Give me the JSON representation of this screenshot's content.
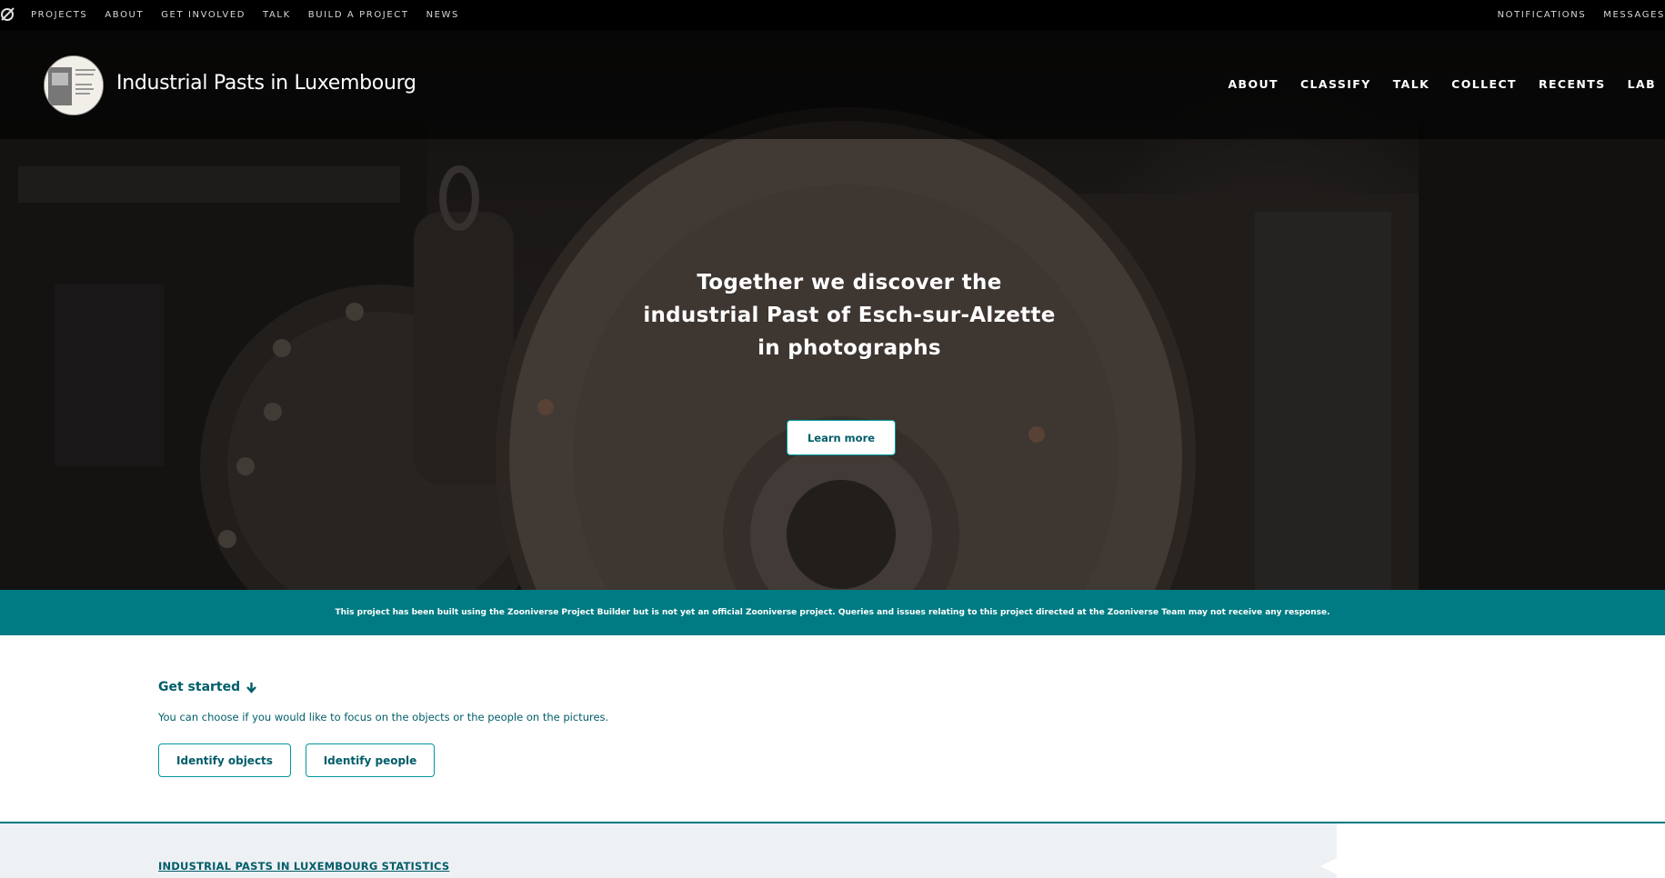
{
  "topbar": {
    "logo_icon": "zooniverse-logo-icon",
    "links": [
      "PROJECTS",
      "ABOUT",
      "GET INVOLVED",
      "TALK",
      "BUILD A PROJECT",
      "NEWS"
    ],
    "right_links": [
      "NOTIFICATIONS",
      "MESSAGES"
    ]
  },
  "project": {
    "title": "Industrial Pasts in Luxembourg",
    "nav": [
      "ABOUT",
      "CLASSIFY",
      "TALK",
      "COLLECT",
      "RECENTS",
      "LAB"
    ]
  },
  "hero": {
    "line1": "Together we discover the",
    "line2": "industrial Past of Esch-sur-Alzette",
    "line3": "in photographs",
    "learn_more": "Learn more"
  },
  "disclaimer": "This project has been built using the Zooniverse Project Builder but is not yet an official Zooniverse project. Queries and issues relating to this project directed at the Zooniverse Team may not receive any response.",
  "get_started": {
    "title": "Get started",
    "icon": "arrow-down-icon",
    "description": "You can choose if you would like to focus on the objects or the people on the pictures.",
    "buttons": [
      "Identify objects",
      "Identify people"
    ]
  },
  "statistics": {
    "link": "INDUSTRIAL PASTS IN LUXEMBOURG STATISTICS"
  },
  "colors": {
    "teal": "#007b83",
    "teal_dark": "#005d69"
  }
}
